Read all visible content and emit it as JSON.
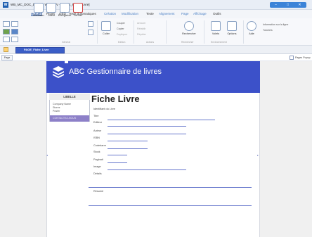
{
  "window": {
    "logo": "W",
    "title": "WB_MC_DOC_Divers - WEBDEV - [PAGE_Fiche_Livre]",
    "controls": [
      "–",
      "□",
      "✕"
    ]
  },
  "menu": [
    {
      "label": "Accueil",
      "style": "active"
    },
    {
      "label": "Projet",
      "style": "normal"
    },
    {
      "label": "GED",
      "style": "normal"
    },
    {
      "label": "Tests automatiques",
      "style": "normal"
    },
    {
      "label": "Création",
      "style": "accent"
    },
    {
      "label": "Modification",
      "style": "accent"
    },
    {
      "label": "Texte",
      "style": "normal"
    },
    {
      "label": "Alignement",
      "style": "accent"
    },
    {
      "label": "Page",
      "style": "accent"
    },
    {
      "label": "Affichage",
      "style": "accent"
    },
    {
      "label": "Outils",
      "style": "normal"
    }
  ],
  "ribbon": {
    "buttons": [
      {
        "label": "Nouveau"
      },
      {
        "label": "Ouvrir"
      },
      {
        "label": "Enregistrer"
      },
      {
        "label": "Fermer"
      },
      {
        "label": "Coller"
      },
      {
        "label": "Rechercher"
      },
      {
        "label": "Volets"
      },
      {
        "label": "Options"
      },
      {
        "label": "Aide"
      }
    ],
    "clipboard": [
      "Couper",
      "Copier",
      "Dupliquer"
    ],
    "undo": [
      "Annuler",
      "Rétablir",
      "Répéter"
    ],
    "info": [
      "Information sur la ligne",
      "Tutoriels"
    ],
    "groups": [
      "Général",
      "Edition",
      "Actions",
      "Rechercher",
      "Environnement"
    ]
  },
  "tabs": {
    "document": "PAGE_Fiche_Livre",
    "page": "Page",
    "popup": "Pages Popup"
  },
  "page": {
    "header_title": "ABC Gestionnaire de livres",
    "sidebar": {
      "heading": "LIBELLE",
      "items": [
        "Company Name",
        "Stores",
        "Poster"
      ],
      "selected": "CONTACTEZ-NOUS"
    },
    "form": {
      "title": "Fiche Livre",
      "subtitle": "Identifiant du Livre",
      "fields": [
        "Titre",
        "Editeur",
        "Auteur",
        "ISBN",
        "Codebarre",
        "Stock",
        "Paginati",
        "Image",
        "Détails",
        "Résumé"
      ]
    }
  }
}
